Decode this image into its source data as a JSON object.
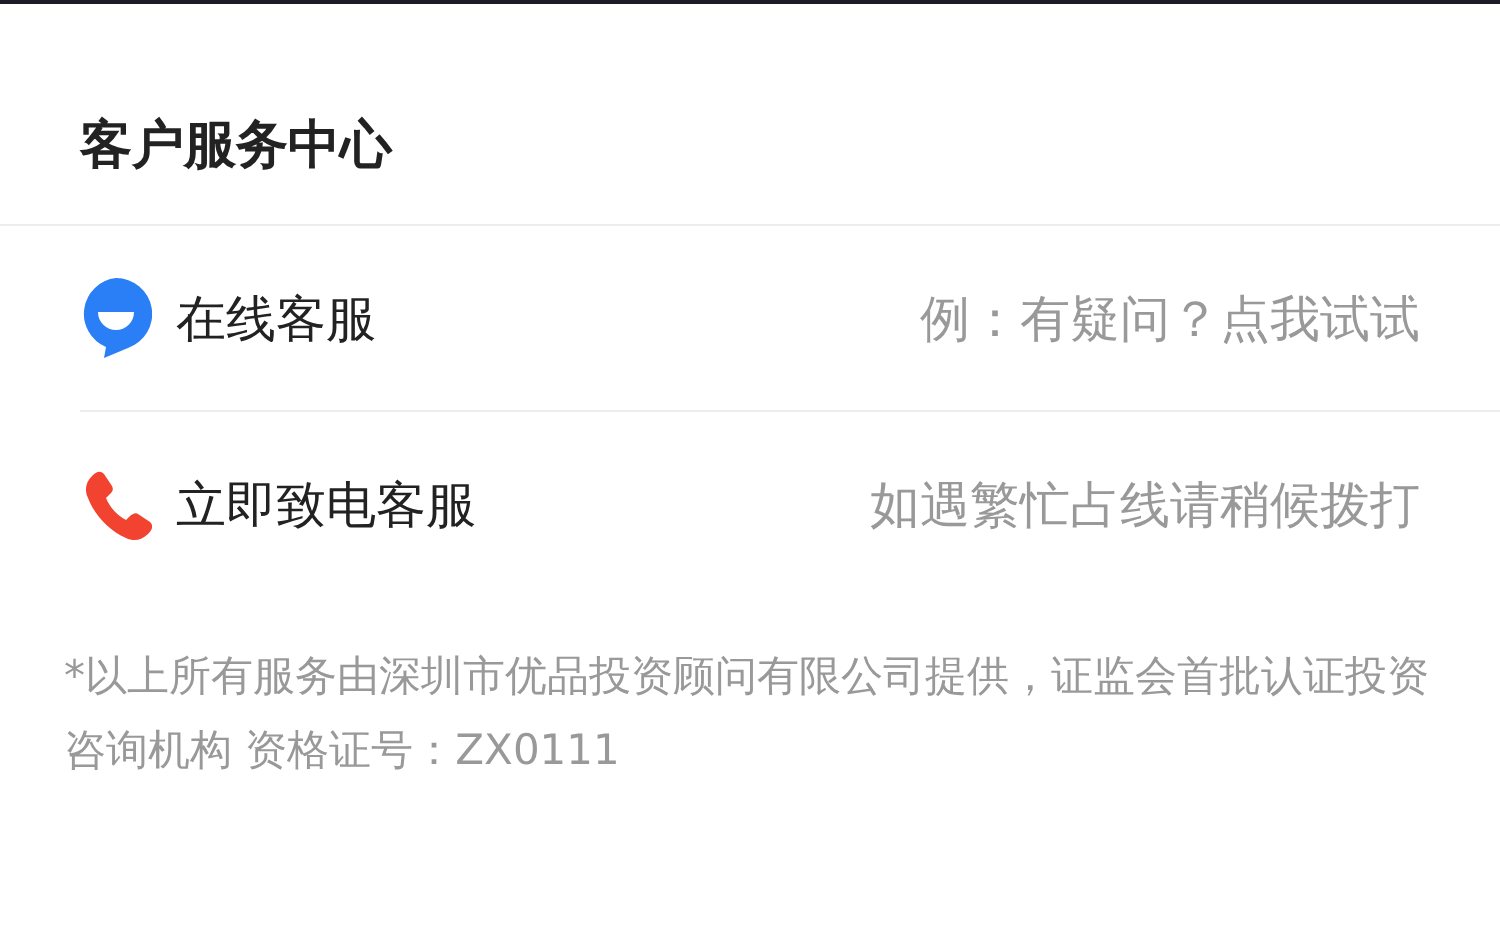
{
  "title": "客户服务中心",
  "services": [
    {
      "kind": "chat",
      "label": "在线客服",
      "hint": "例：有疑问？点我试试"
    },
    {
      "kind": "phone",
      "label": "立即致电客服",
      "hint": "如遇繁忙占线请稍候拨打"
    }
  ],
  "footnote": "*以上所有服务由深圳市优品投资顾问有限公司提供，证监会首批认证投资咨询机构 资格证号：ZX0111"
}
